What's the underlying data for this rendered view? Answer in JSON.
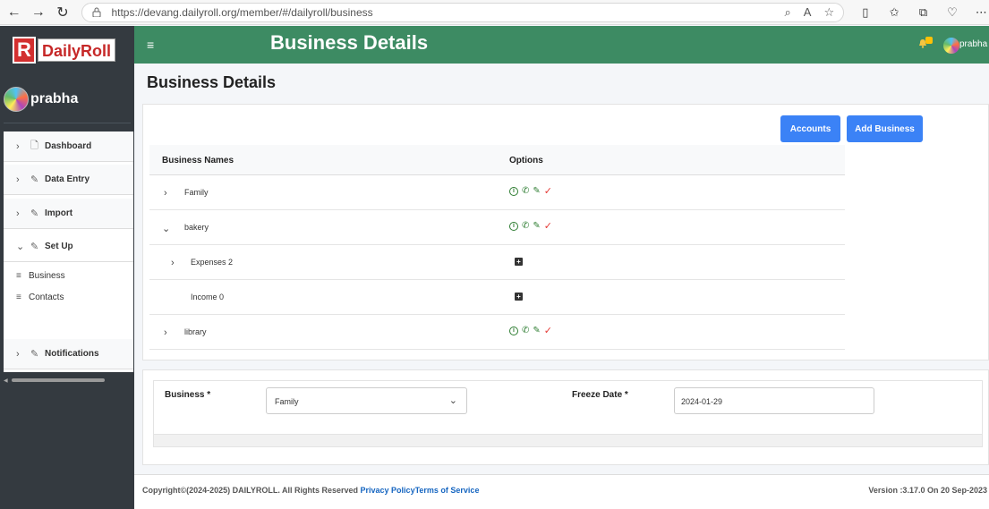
{
  "browser": {
    "url": "https://devang.dailyroll.org/member/#/dailyroll/business"
  },
  "sidebar": {
    "logo_mark": "R",
    "logo_text": "DailyRoll",
    "user_name": "prabha",
    "menu": [
      {
        "label": "Dashboard",
        "expanded": false
      },
      {
        "label": "Data Entry",
        "expanded": false
      },
      {
        "label": "Import",
        "expanded": false
      },
      {
        "label": "Set Up",
        "expanded": true
      },
      {
        "label": "Notifications",
        "expanded": false
      }
    ],
    "setup_items": [
      {
        "label": "Business"
      },
      {
        "label": "Contacts"
      }
    ]
  },
  "topbar": {
    "title": "Business Details",
    "notification_count": "0",
    "user_name": "prabha"
  },
  "page": {
    "title": "Business Details"
  },
  "business_card": {
    "accounts_label": "Accounts",
    "add_business_label": "Add Business",
    "columns": [
      "Business Names",
      "Options"
    ],
    "rows": [
      {
        "name": "Family",
        "level": 0,
        "expanded": false
      },
      {
        "name": "bakery",
        "level": 0,
        "expanded": true
      },
      {
        "name": "Expenses 2",
        "level": 1,
        "expanded": false
      },
      {
        "name": "Income 0",
        "level": 1,
        "expanded": false
      },
      {
        "name": "library",
        "level": 0,
        "expanded": false
      }
    ]
  },
  "form": {
    "business_label": "Business *",
    "business_value": "Family",
    "freeze_label": "Freeze Date *",
    "freeze_value": "2024-01-29"
  },
  "footer": {
    "copyright": "Copyright©(2024-2025) DAILYROLL. All Rights Reserved ",
    "privacy": "Privacy Policy",
    "terms": "Terms of Service",
    "version": "Version :3.17.0 On 20 Sep-2023"
  },
  "colors": {
    "topbar": "#3d8b63",
    "sidebar": "#343a40",
    "button": "#3b82f6",
    "option_icon": "#2e7d32",
    "check_icon": "#e53935"
  },
  "icons": {
    "row_options": [
      "info-icon",
      "phone-icon",
      "pencil-icon",
      "check-icon"
    ],
    "sub_row_action": "plus-square-icon"
  }
}
